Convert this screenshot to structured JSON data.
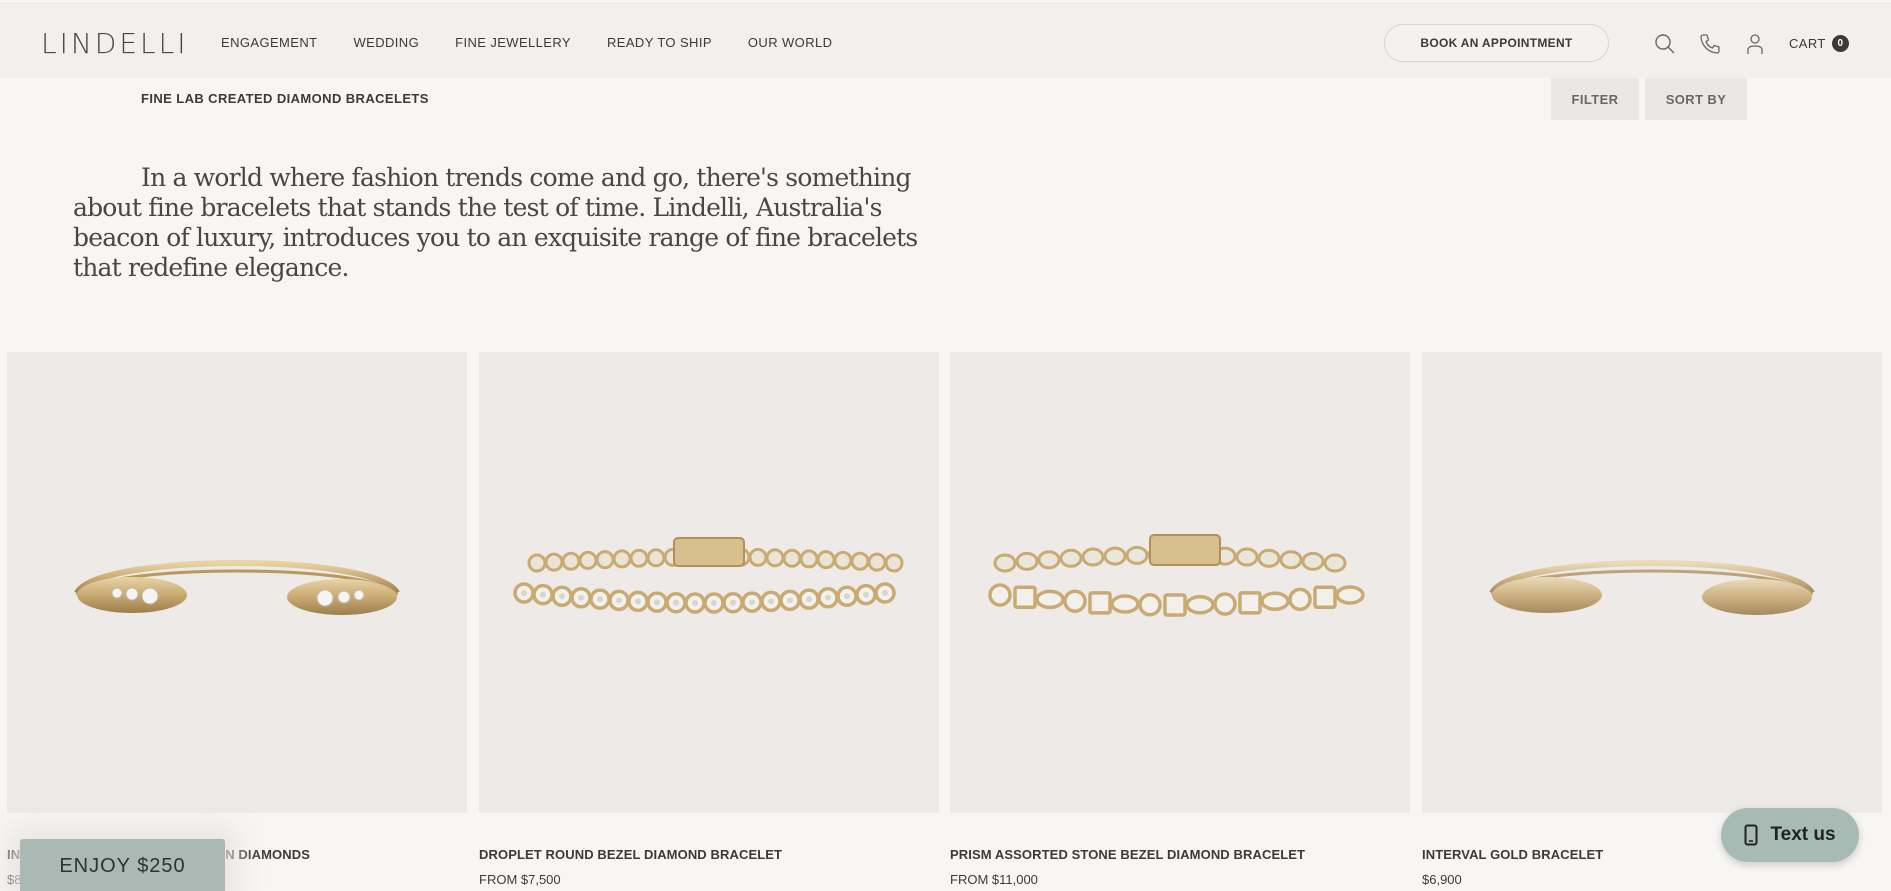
{
  "header": {
    "logo": "LINDELLI",
    "nav": [
      "ENGAGEMENT",
      "WEDDING",
      "FINE JEWELLERY",
      "READY TO SHIP",
      "OUR WORLD"
    ],
    "book_label": "BOOK AN APPOINTMENT",
    "icons": [
      "search-icon",
      "phone-icon",
      "account-icon"
    ],
    "cart_label": "CART",
    "cart_count": "0"
  },
  "subheader": {
    "title": "FINE LAB CREATED DIAMOND BRACELETS",
    "filter_label": "FILTER",
    "sort_label": "SORT BY"
  },
  "intro": {
    "text": "In a world where fashion trends come and go, there's something about fine bracelets that stands the test of time. Lindelli, Australia's beacon of luxury, introduces you to an exquisite range of fine bracelets that redefine elegance."
  },
  "products": [
    {
      "name": "IN",
      "name_tail": "N DIAMONDS",
      "price": "$8",
      "image": "open-cuff-with-diamonds"
    },
    {
      "name": "DROPLET ROUND BEZEL DIAMOND BRACELET",
      "price": "FROM $7,500",
      "image": "round-bezel-tennis-bracelet"
    },
    {
      "name": "PRISM ASSORTED STONE BEZEL DIAMOND BRACELET",
      "price": "FROM $11,000",
      "image": "assorted-stone-bezel-bracelet"
    },
    {
      "name": "INTERVAL GOLD BRACELET",
      "price": "$6,900",
      "image": "open-gold-cuff"
    }
  ],
  "promo": {
    "label": "ENJOY $250"
  },
  "chat": {
    "label": "Text us",
    "icon": "mobile-phone-icon"
  },
  "colors": {
    "background": "#f8f6f4",
    "header": "#f2efec",
    "product_bg": "#edeae7",
    "accent_sage": "#aab9b3",
    "gold": "#c9aa72"
  }
}
